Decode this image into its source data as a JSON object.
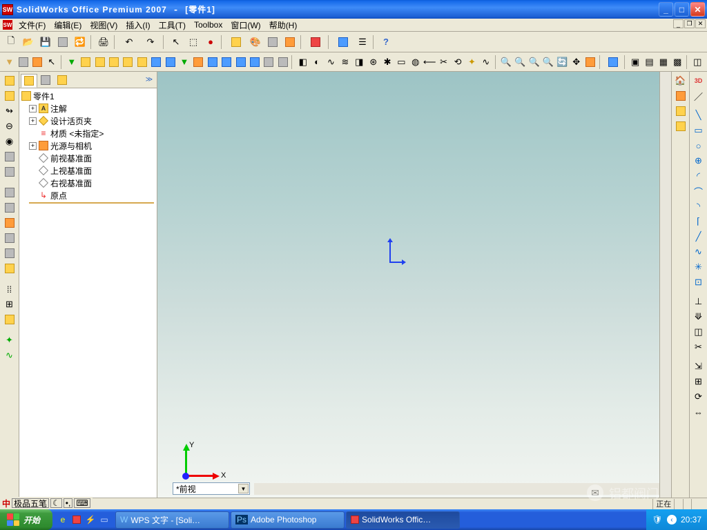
{
  "titlebar": {
    "app": "SolidWorks Office Premium 2007",
    "doc": "[零件1]"
  },
  "menu": {
    "file": "文件(F)",
    "edit": "编辑(E)",
    "view": "视图(V)",
    "insert": "插入(I)",
    "tools": "工具(T)",
    "toolbox": "Toolbox",
    "window": "窗口(W)",
    "help": "帮助(H)"
  },
  "tree": {
    "root": "零件1",
    "annotations": "注解",
    "design_binder": "设计活页夹",
    "material": "材质 <未指定>",
    "light_camera": "光源与相机",
    "front_plane": "前视基准面",
    "top_plane": "上视基准面",
    "right_plane": "右视基准面",
    "origin": "原点"
  },
  "viewport": {
    "view_selector": "*前视",
    "axis_y": "Y",
    "axis_x": "X"
  },
  "statusbar": {
    "editing_prefix": "正在"
  },
  "ime": {
    "name": "极品五笔"
  },
  "taskbar": {
    "start": "开始",
    "tasks": [
      {
        "icon": "wps",
        "label": "WPS 文字 - [Soli…"
      },
      {
        "icon": "ps",
        "label": "Adobe Photoshop"
      },
      {
        "icon": "sw",
        "label": "SolidWorks Offic…"
      }
    ],
    "time": "20:37"
  },
  "watermark": "铝都阀门"
}
